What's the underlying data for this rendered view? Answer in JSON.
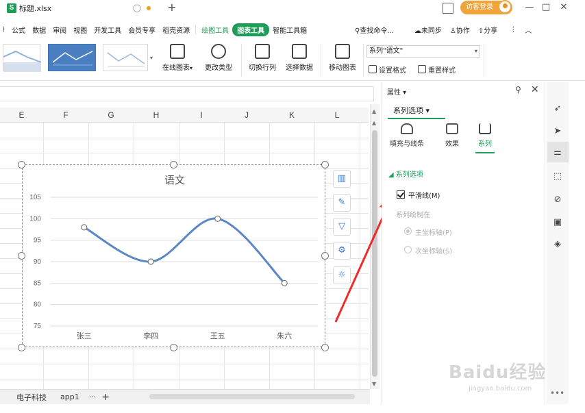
{
  "window": {
    "file_icon_letter": "S",
    "file_name": "标题.xlsx",
    "add_tab": "+",
    "login_label": "访客登录",
    "minimize": "—",
    "maximize": "□",
    "close": "✕"
  },
  "menu": {
    "items": [
      "公式",
      "数据",
      "审阅",
      "视图",
      "开发工具",
      "会员专享",
      "稻壳资源"
    ],
    "draw_tools": "绘图工具",
    "chart_tools": "图表工具",
    "smart_toolbox": "智能工具箱",
    "search": "查找命令...",
    "unsynced": "未同步",
    "collab": "协作",
    "share": "分享"
  },
  "ribbon": {
    "online_chart": "在线图表",
    "change_type": "更改类型",
    "switch_rowcol": "切换行列",
    "select_data": "选择数据",
    "move_chart": "移动图表",
    "series_selected": "系列\"语文\"",
    "set_format": "设置格式",
    "reset_style": "重置样式"
  },
  "sheet": {
    "columns": [
      "E",
      "F",
      "G",
      "H",
      "I",
      "J",
      "K",
      "L"
    ],
    "tabs": [
      "电子科技",
      "app1"
    ],
    "more": "···",
    "add": "+"
  },
  "chart_data": {
    "type": "line",
    "title": "语文",
    "categories": [
      "张三",
      "李四",
      "王五",
      "朱六"
    ],
    "series": [
      {
        "values": [
          98,
          90,
          100,
          85
        ],
        "smooth": true,
        "color": "#5b87c4"
      }
    ],
    "ylim": [
      75,
      105
    ],
    "yticks": [
      105,
      100,
      95,
      90,
      85,
      80,
      75
    ],
    "grid": true,
    "legend": "none"
  },
  "panel": {
    "title": "属性",
    "tab": "系列选项",
    "subtabs": [
      "填充与线条",
      "效果",
      "系列"
    ],
    "section": "系列选项",
    "smooth_label": "平滑线(M)",
    "smooth_checked": true,
    "plot_on": "系列绘制在",
    "primary_axis": "主坐标轴(P)",
    "secondary_axis": "次坐标轴(S)"
  },
  "watermark": {
    "logo": "Baidu经验",
    "url": "jingyan.baidu.com"
  },
  "colors": {
    "accent": "#1d9c5a",
    "series": "#5b87c4",
    "arrow": "#ee2b2b",
    "login": "#f0a43a"
  }
}
